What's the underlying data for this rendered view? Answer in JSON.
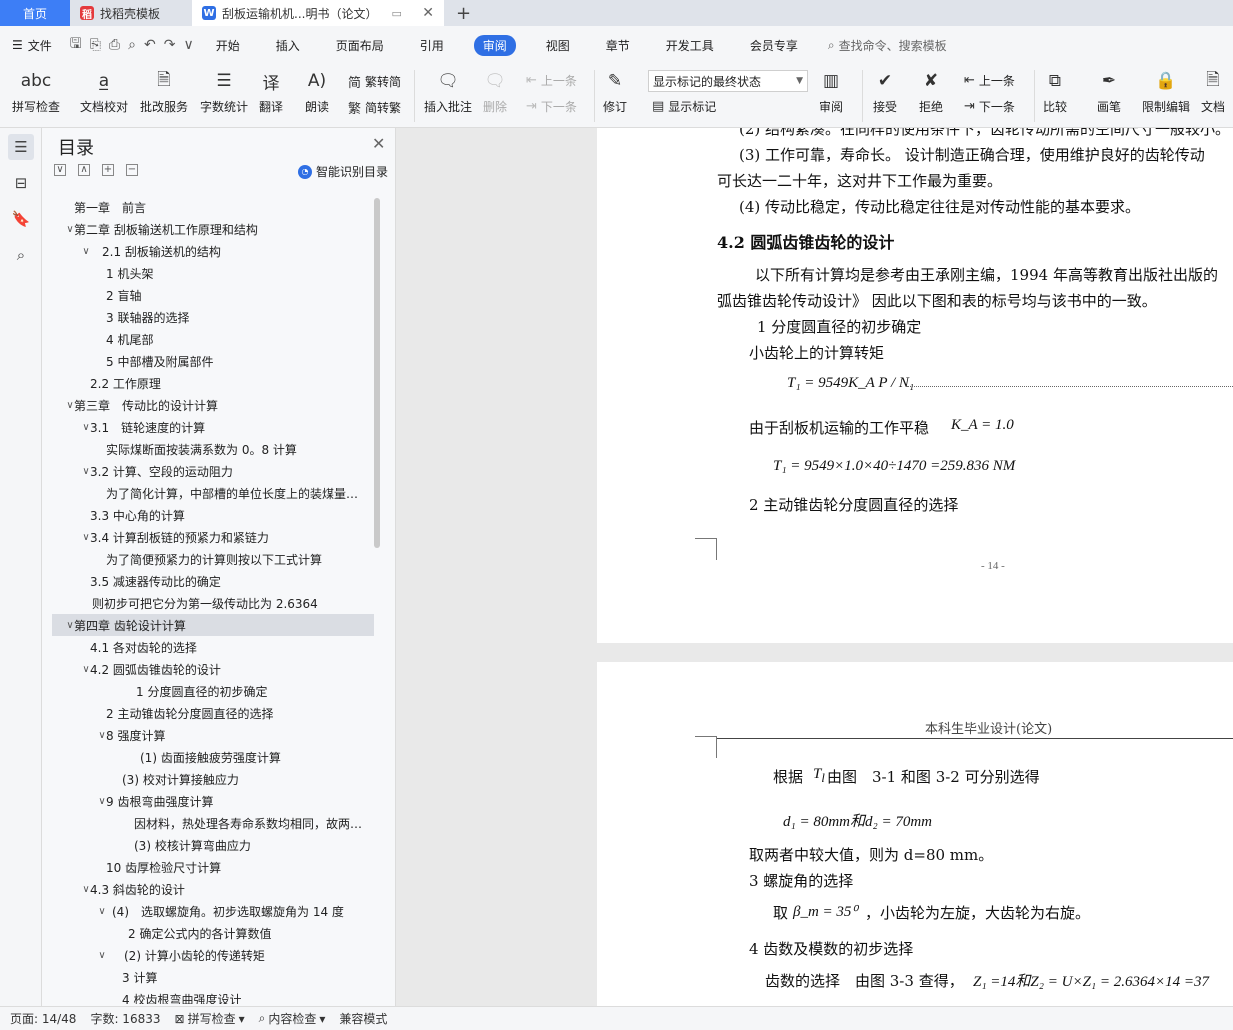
{
  "tabs": {
    "home": "首页",
    "docer": "找稻壳模板",
    "doc": "刮板运输机机...明书（论文）"
  },
  "menu": {
    "file": "文件",
    "items": [
      "开始",
      "插入",
      "页面布局",
      "引用",
      "审阅",
      "视图",
      "章节",
      "开发工具",
      "会员专享"
    ],
    "search": "查找命令、搜索模板"
  },
  "ribbon": {
    "spell": "拼写检查",
    "proof": "文档校对",
    "batch": "批改服务",
    "wordcount": "字数统计",
    "translate": "翻译",
    "read": "朗读",
    "to_trad": "繁转简",
    "to_simp": "简转繁",
    "insert_comment": "插入批注",
    "delete": "删除",
    "prev": "上一条",
    "next": "下一条",
    "revise": "修订",
    "markup_select": "显示标记的最终状态",
    "show_markup": "显示标记",
    "review": "审阅",
    "accept": "接受",
    "reject": "拒绝",
    "prev2": "上一条",
    "next2": "下一条",
    "compare": "比较",
    "pen": "画笔",
    "restrict": "限制编辑",
    "doc_more": "文档"
  },
  "toc": {
    "title": "目录",
    "smart": "智能识别目录",
    "items": [
      {
        "label": "第一章　前言",
        "exp": ""
      },
      {
        "label": "第二章 刮板输送机工作原理和结构",
        "exp": "∨"
      },
      {
        "label": "2.1 刮板输送机的结构",
        "exp": "∨"
      },
      {
        "label": "1 机头架",
        "exp": ""
      },
      {
        "label": "2 盲轴",
        "exp": ""
      },
      {
        "label": "3 联轴器的选择",
        "exp": ""
      },
      {
        "label": "4 机尾部",
        "exp": ""
      },
      {
        "label": "5 中部槽及附属部件",
        "exp": ""
      },
      {
        "label": "2.2 工作原理",
        "exp": ""
      },
      {
        "label": "第三章　传动比的设计计算",
        "exp": "∨"
      },
      {
        "label": "3.1　链轮速度的计算",
        "exp": "∨"
      },
      {
        "label": "实际煤断面按装满系数为 0。8 计算",
        "exp": ""
      },
      {
        "label": "3.2 计算、空段的运动阻力",
        "exp": "∨"
      },
      {
        "label": "为了简化计算，中部槽的单位长度上的装煤量按装满系数为",
        "exp": ""
      },
      {
        "label": "3.3 中心角的计算",
        "exp": ""
      },
      {
        "label": "3.4 计算刮板链的预紧力和紧链力",
        "exp": "∨"
      },
      {
        "label": "为了简便预紧力的计算则按以下工式计算",
        "exp": ""
      },
      {
        "label": "3.5 减速器传动比的确定",
        "exp": ""
      },
      {
        "label": "则初步可把它分为第一级传动比为 2.6364",
        "exp": ""
      },
      {
        "label": "第四章 齿轮设计计算",
        "exp": "∨"
      },
      {
        "label": "4.1 各对齿轮的选择",
        "exp": ""
      },
      {
        "label": "4.2 圆弧齿锥齿轮的设计",
        "exp": "∨"
      },
      {
        "label": "1 分度圆直径的初步确定",
        "exp": ""
      },
      {
        "label": "2 主动锥齿轮分度圆直径的选择",
        "exp": ""
      },
      {
        "label": "8 强度计算",
        "exp": "∨"
      },
      {
        "label": "(1) 齿面接触疲劳强度计算",
        "exp": ""
      },
      {
        "label": "(3) 校对计算接触应力",
        "exp": ""
      },
      {
        "label": "9 齿根弯曲强度计算",
        "exp": "∨"
      },
      {
        "label": "因材料，热处理各寿命系数均相同，故两齿轮的许用应力相同",
        "exp": ""
      },
      {
        "label": "(3) 校核计算弯曲应力",
        "exp": ""
      },
      {
        "label": "10 齿厚检验尺寸计算",
        "exp": ""
      },
      {
        "label": "4.3 斜齿轮的设计",
        "exp": "∨"
      },
      {
        "label": "(4)　选取螺旋角。初步选取螺旋角为 14 度",
        "exp": "∨"
      },
      {
        "label": "2 确定公式内的各计算数值",
        "exp": ""
      },
      {
        "label": "(2) 计算小齿轮的传递转矩",
        "exp": "∨"
      },
      {
        "label": "3 计算",
        "exp": ""
      },
      {
        "label": "4 校齿根弯曲强度设计",
        "exp": ""
      }
    ]
  },
  "page1": {
    "l0": "(2) 结构紧凑。在同样的使用条件下，齿轮传动所需的空间尺寸一般较小。",
    "l1": "(3) 工作可靠，寿命长。 设计制造正确合理，使用维护良好的齿轮传动",
    "l2": "可长达一二十年，这对井下工作最为重要。",
    "l3": "(4) 传动比稳定，传动比稳定往往是对传动性能的基本要求。",
    "h": "4.2  圆弧齿锥齿轮的设计",
    "l4": "以下所有计算均是参考由王承刚主编，1994 年高等教育出版社出版的",
    "l5": "弧齿锥齿轮传动设计》 因此以下图和表的标号均与该书中的一致。",
    "l6": "1 分度圆直径的初步确定",
    "l7": "小齿轮上的计算转矩",
    "f1": "T₁ = 9549K_A P / N₁",
    "l8": "由于刮板机运输的工作平稳",
    "f2": "K_A = 1.0",
    "f3": "T₁ = 9549×1.0×40÷1470 =259.836 NM",
    "l9": "2 主动锥齿轮分度圆直径的选择",
    "pnum": "- 14 -"
  },
  "page2": {
    "header": "本科生毕业设计(论文)",
    "l1": "根据",
    "l1b": "由图　3-1 和图 3-2 可分别选得",
    "f1": "d₁ = 80mm和d₂ = 70mm",
    "l2": "取两者中较大值，则为 d=80 mm。",
    "l3": "3 螺旋角的选择",
    "l4a": "取",
    "f2": "β_m = 35⁰",
    "l4b": "，小齿轮为左旋，大齿轮为右旋。",
    "l5": "4 齿数及模数的初步选择",
    "l6": "齿数的选择　由图 3-3 查得，",
    "f3": "Z₁ =14和Z₂ = U×Z₁ = 2.6364×14 =37"
  },
  "status": {
    "page": "页面: 14/48",
    "words": "字数: 16833",
    "spell": "拼写检查",
    "content": "内容检查",
    "compat": "兼容模式"
  }
}
